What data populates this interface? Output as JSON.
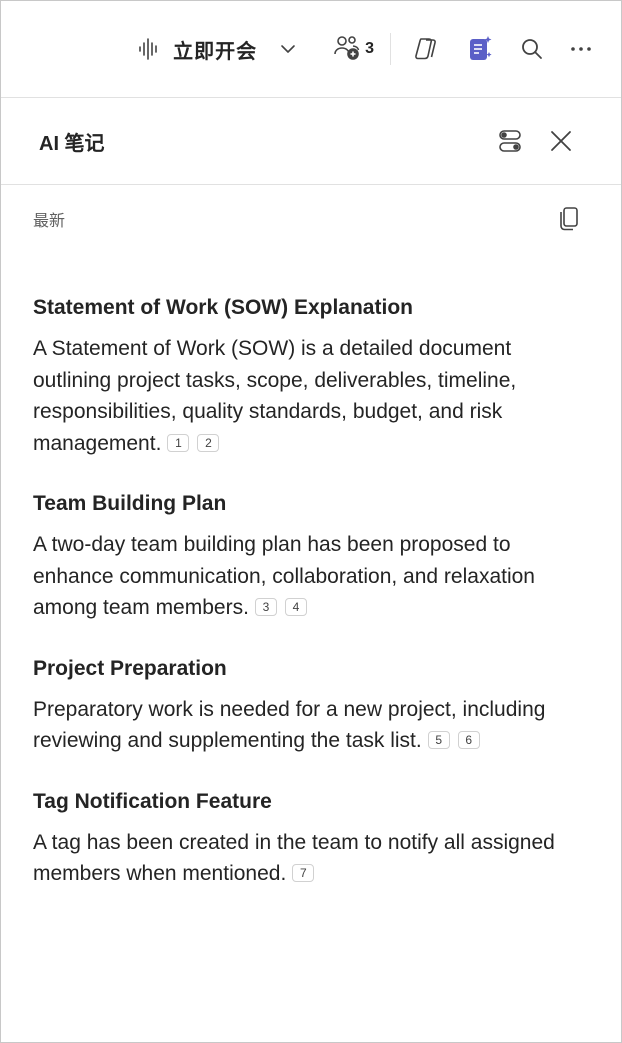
{
  "topbar": {
    "meet_label": "立即开会",
    "participants_count": "3"
  },
  "panel": {
    "title": "AI 笔记"
  },
  "content": {
    "latest_label": "最新",
    "sections": [
      {
        "title": "Statement of Work (SOW) Explanation",
        "body": "A Statement of Work (SOW) is a detailed document outlining project tasks, scope, deliverables, timeline, responsibilities, quality standards, budget, and risk management.",
        "citations": [
          "1",
          "2"
        ]
      },
      {
        "title": "Team Building Plan",
        "body": "A two-day team building plan has been proposed to enhance communication, collaboration, and relaxation among team members.",
        "citations": [
          "3",
          "4"
        ]
      },
      {
        "title": "Project Preparation",
        "body": "Preparatory work is needed for a new project, including reviewing and supplementing the task list.",
        "citations": [
          "5",
          "6"
        ]
      },
      {
        "title": "Tag Notification Feature",
        "body": "A tag has been created in the team to notify all assigned members when mentioned.",
        "citations": [
          "7"
        ]
      }
    ]
  },
  "colors": {
    "text": "#242424",
    "muted": "#616161",
    "accent": "#5b5fc7",
    "border": "#e1e1e1"
  },
  "icons": [
    "audio-wave-icon",
    "chevron-down-icon",
    "add-people-icon",
    "copilot-icon",
    "ai-notes-icon",
    "search-icon",
    "more-icon",
    "toggle-settings-icon",
    "close-icon",
    "copy-icon"
  ]
}
